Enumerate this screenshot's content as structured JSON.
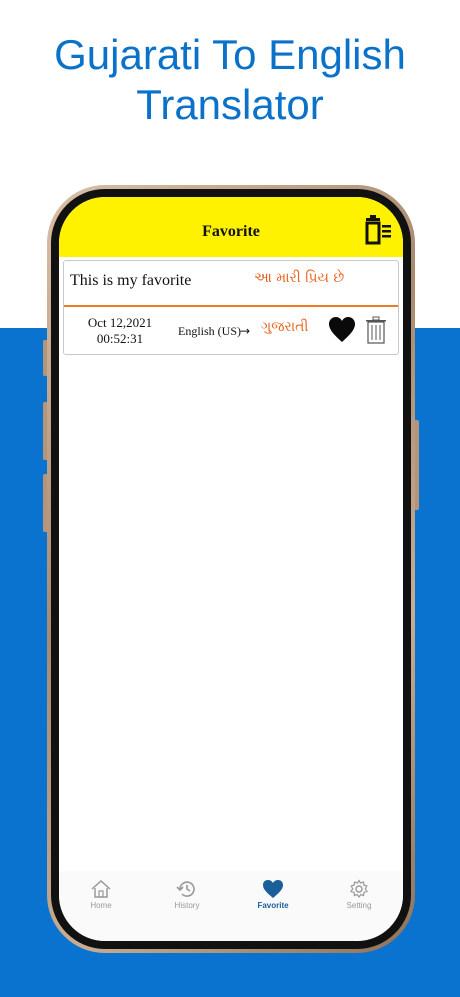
{
  "promo": {
    "title_line1": "Gujarati To English",
    "title_line2": "Translator"
  },
  "colors": {
    "promo_blue": "#0b72c9",
    "band_blue": "#0a72cf",
    "nav_yellow": "#fff200",
    "accent_orange": "#e8621a",
    "active_tab": "#1a5f9a"
  },
  "header": {
    "title": "Favorite",
    "clear_icon": "delete-all-icon"
  },
  "favorites": [
    {
      "source_text": "This is my favorite",
      "translated_text": "આ મારી પ્રિય છે",
      "date": "Oct 12,2021",
      "time": "00:52:31",
      "from_lang": "English (US)",
      "arrow": "→",
      "to_lang": "ગુજરાતી",
      "favorite_icon": "heart-filled-icon",
      "delete_icon": "trash-icon"
    }
  ],
  "tabs": [
    {
      "label": "Home",
      "icon": "home-icon",
      "active": false
    },
    {
      "label": "History",
      "icon": "history-icon",
      "active": false
    },
    {
      "label": "Favorite",
      "icon": "heart-icon",
      "active": true
    },
    {
      "label": "Setting",
      "icon": "gear-icon",
      "active": false
    }
  ]
}
